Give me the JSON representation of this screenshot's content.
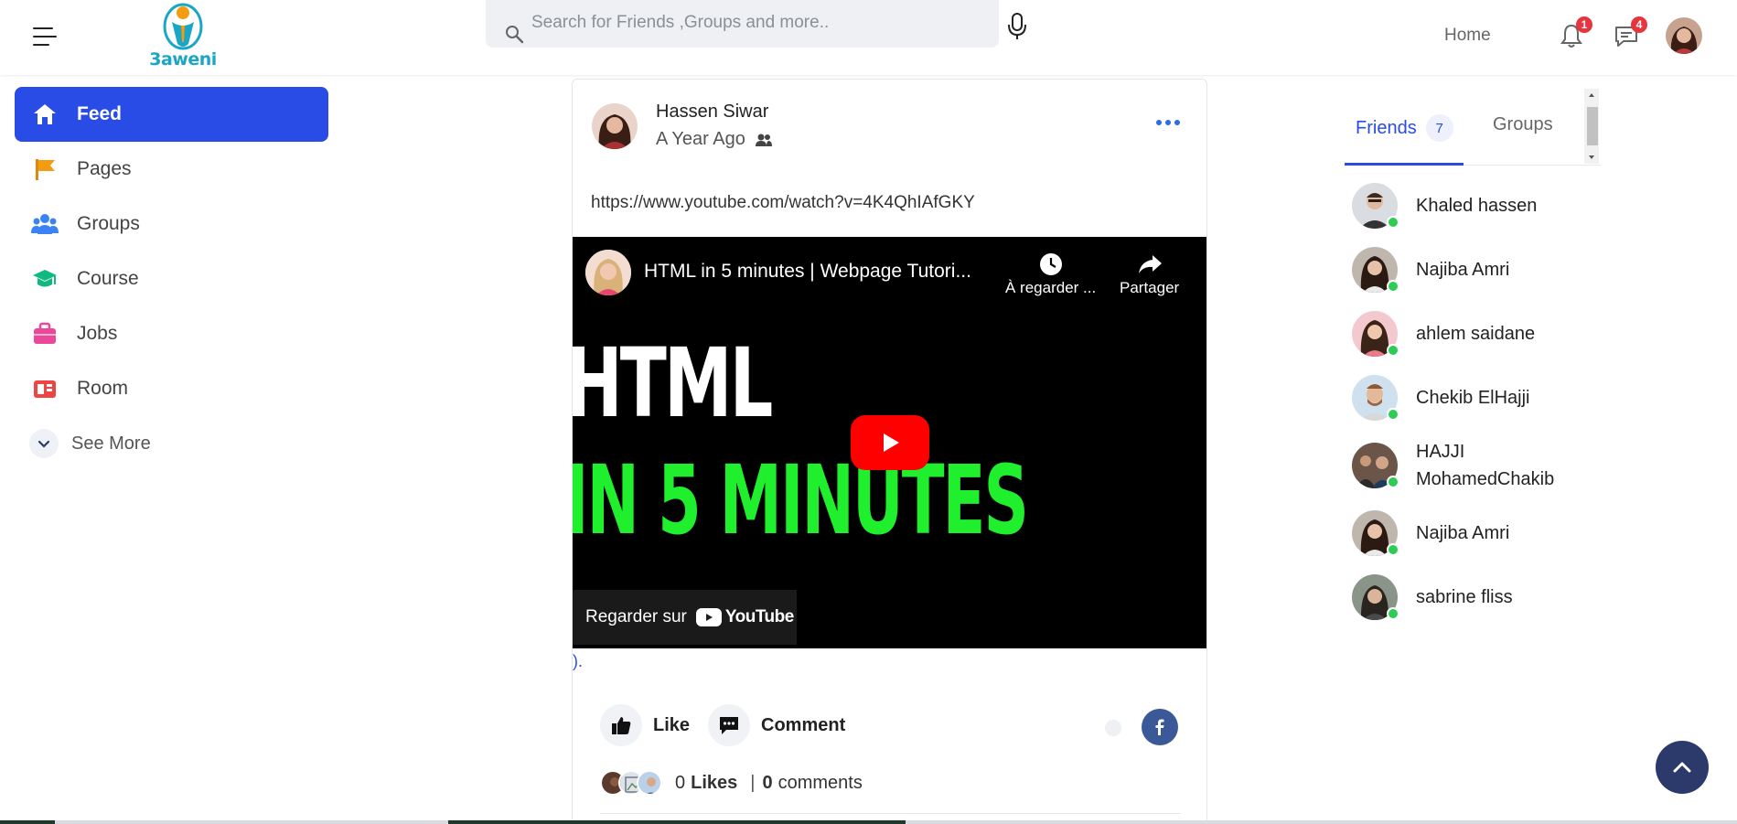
{
  "header": {
    "logo_text": "3aweni",
    "search_placeholder": "Search for Friends ,Groups and more..",
    "home_label": "Home",
    "notifications_count": "1",
    "messages_count": "4"
  },
  "sidebar": {
    "items": [
      {
        "label": "Feed",
        "icon": "home-icon",
        "color": "#ffffff"
      },
      {
        "label": "Pages",
        "icon": "flag-icon",
        "color": "#f39c12"
      },
      {
        "label": "Groups",
        "icon": "users-icon",
        "color": "#3b82f6"
      },
      {
        "label": "Course",
        "icon": "graduation-cap-icon",
        "color": "#10b981"
      },
      {
        "label": "Jobs",
        "icon": "briefcase-icon",
        "color": "#ec4899"
      },
      {
        "label": "Room",
        "icon": "room-icon",
        "color": "#ef4444"
      }
    ],
    "see_more": "See More"
  },
  "post": {
    "author": "Hassen Siwar",
    "time": "A Year Ago",
    "url_text": "https://www.youtube.com/watch?v=4K4QhIAfGKY",
    "video": {
      "title": "HTML in 5 minutes | Webpage Tutori...",
      "watch_later": "À regarder ...",
      "share": "Partager",
      "thumb_line1": "HTML",
      "thumb_line2": "IN 5 MINUTES",
      "watch_on": "Regarder sur",
      "youtube": "YouTube"
    },
    "trail": ").",
    "like_label": "Like",
    "comment_label": "Comment",
    "likes_count": "0",
    "likes_word": "Likes",
    "comments_count": "0",
    "comments_word": "comments"
  },
  "friends_panel": {
    "tab_friends": "Friends",
    "friends_count": "7",
    "tab_groups": "Groups",
    "friends": [
      {
        "name": "Khaled hassen"
      },
      {
        "name": "Najiba Amri"
      },
      {
        "name": "ahlem saidane"
      },
      {
        "name": "Chekib ElHajji"
      },
      {
        "name": "HAJJI MohamedChakib"
      },
      {
        "name": "Najiba Amri"
      },
      {
        "name": "sabrine fliss"
      }
    ]
  },
  "colors": {
    "accent": "#2a4ce6",
    "online": "#2ecc55",
    "badge": "#e8343f",
    "scroll_top": "#2b3a6b"
  }
}
